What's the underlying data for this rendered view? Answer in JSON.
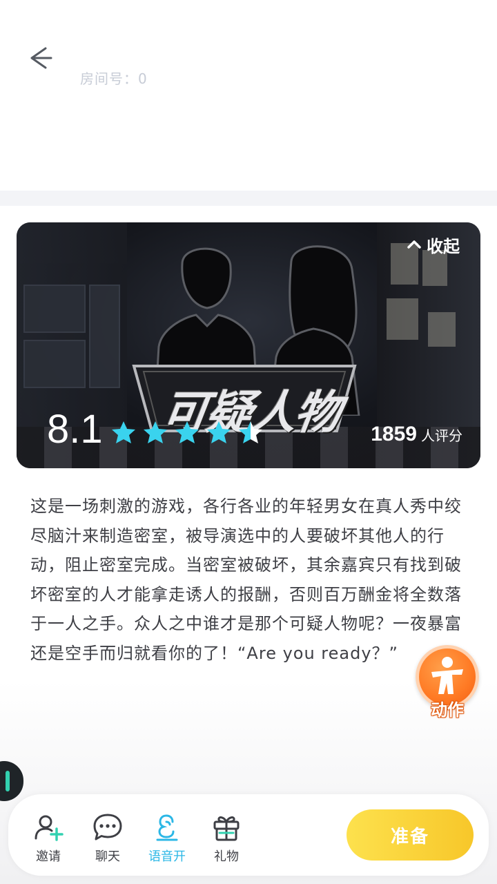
{
  "header": {
    "room_label": "房间号：0"
  },
  "banner": {
    "game_title": "可疑人物",
    "collapse_label": "收起",
    "rating": {
      "score": "8.1",
      "stars": 4.5,
      "stars_max": 5,
      "count": "1859",
      "count_unit": "人评分"
    }
  },
  "description": "这是一场刺激的游戏，各行各业的年轻男女在真人秀中绞尽脑汁来制造密室，被导演选中的人要破坏其他人的行动，阻止密室完成。当密室被破坏，其余嘉宾只有找到破坏密室的人才能拿走诱人的报酬，否则百万酬金将全数落于一人之手。众人之中谁才是那个可疑人物呢？一夜暴富还是空手而归就看你的了！“Are you ready？”",
  "action_fab": {
    "label": "动作"
  },
  "bottom_nav": {
    "items": [
      {
        "label": "邀请",
        "icon": "invite-user-icon"
      },
      {
        "label": "聊天",
        "icon": "chat-bubble-icon"
      },
      {
        "label": "语音开",
        "icon": "voice-on-icon"
      },
      {
        "label": "礼物",
        "icon": "gift-icon"
      }
    ],
    "ready_label": "准备"
  },
  "colors": {
    "accent_blue": "#2bb7e6",
    "star_cyan": "#3ad3ee",
    "ready_yellow": "#fbd63a",
    "action_orange": "#ff7a24",
    "teal": "#32d1b0"
  }
}
